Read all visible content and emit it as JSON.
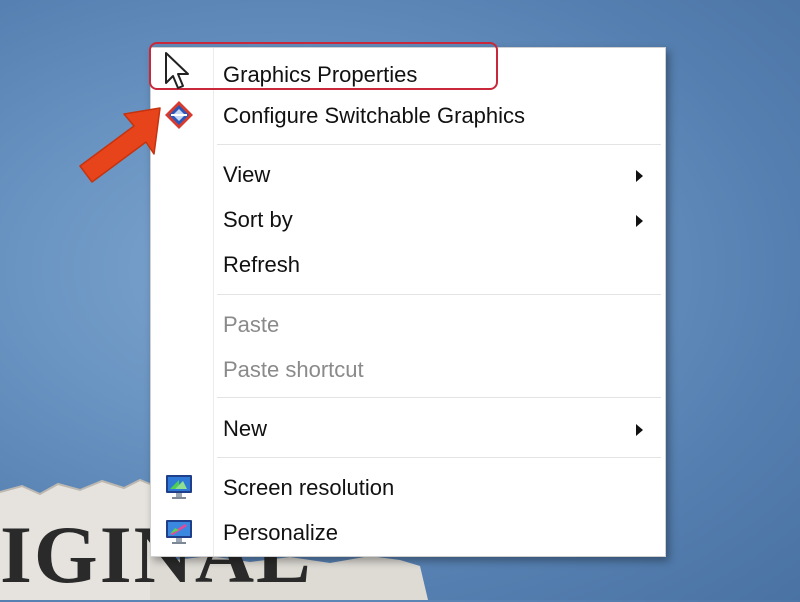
{
  "desktop": {
    "background_color": "#6a94c2",
    "wallpaper_fragment_text": "IGINAL"
  },
  "context_menu": {
    "items": [
      {
        "label": "Graphics Properties",
        "icon": "mouse-pointer-icon",
        "enabled": true,
        "has_submenu": false
      },
      {
        "label": "Configure Switchable Graphics",
        "icon": "switchable-graphics-icon",
        "enabled": true,
        "has_submenu": false
      },
      {
        "label": "View",
        "enabled": true,
        "has_submenu": true
      },
      {
        "label": "Sort by",
        "enabled": true,
        "has_submenu": true
      },
      {
        "label": "Refresh",
        "enabled": true,
        "has_submenu": false
      },
      {
        "label": "Paste",
        "enabled": false,
        "has_submenu": false
      },
      {
        "label": "Paste shortcut",
        "enabled": false,
        "has_submenu": false
      },
      {
        "label": "New",
        "enabled": true,
        "has_submenu": true
      },
      {
        "label": "Screen resolution",
        "icon": "monitor-resolution-icon",
        "enabled": true,
        "has_submenu": false
      },
      {
        "label": "Personalize",
        "icon": "monitor-personalize-icon",
        "enabled": true,
        "has_submenu": false
      }
    ]
  },
  "annotations": {
    "highlight_color": "#c8283a",
    "arrow_color": "#e8441c"
  }
}
